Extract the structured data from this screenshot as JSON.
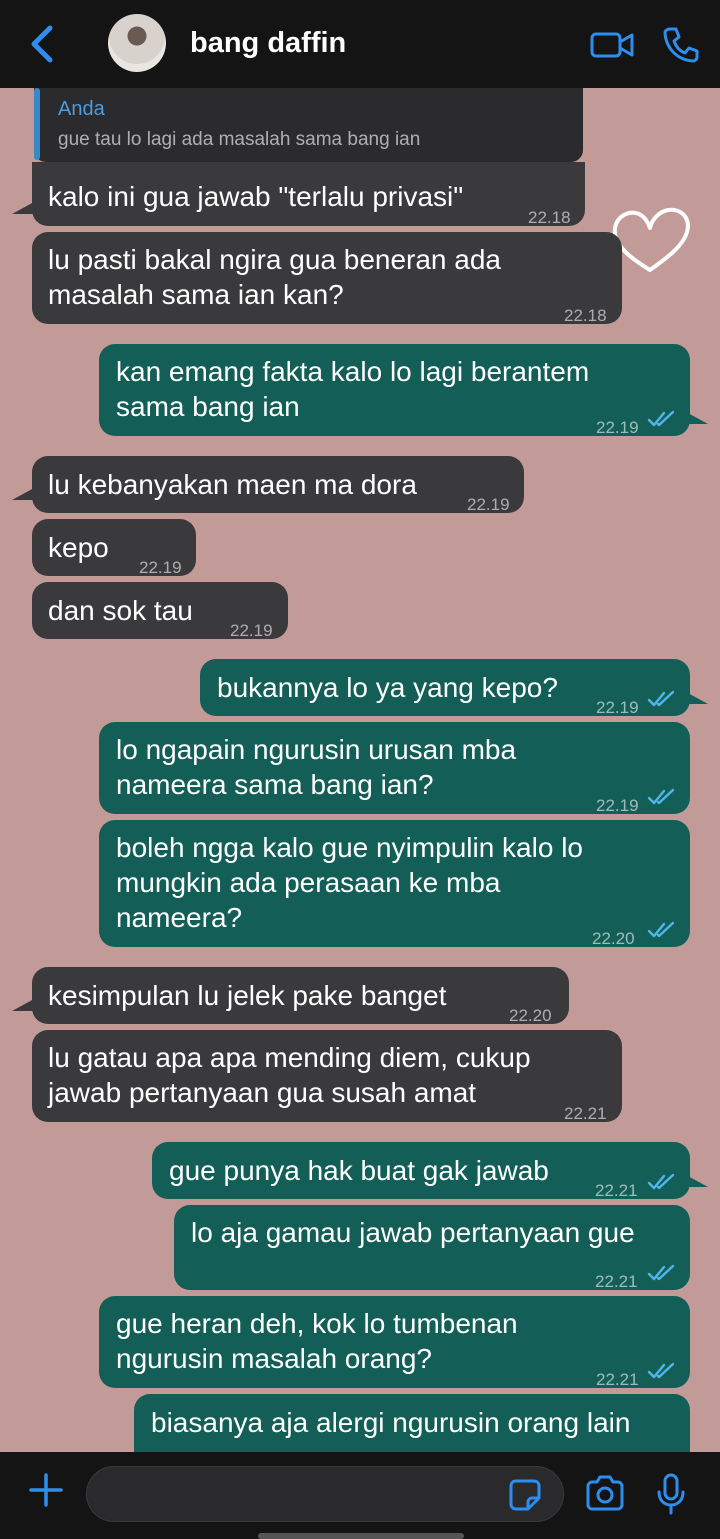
{
  "header": {
    "back_icon": "chevron-left-icon",
    "contact_name": "bang daffin",
    "video_icon": "video-camera-icon",
    "phone_icon": "phone-icon",
    "accent": "#2e8ef0"
  },
  "reply_quote": {
    "author": "Anda",
    "text": "gue tau lo lagi ada masalah sama bang ian"
  },
  "messages": [
    {
      "dir": "in",
      "text": "kalo ini gua jawab \"terlalu privasi\"",
      "time": "22.18"
    },
    {
      "dir": "in",
      "text": "lu pasti bakal ngira gua beneran ada\nmasalah sama ian kan?",
      "time": "22.18"
    },
    {
      "dir": "out",
      "text": "kan emang fakta kalo lo lagi berantem\nsama bang ian",
      "time": "22.19",
      "read": true
    },
    {
      "dir": "in",
      "text": "lu kebanyakan maen ma dora",
      "time": "22.19"
    },
    {
      "dir": "in",
      "text": "kepo",
      "time": "22.19"
    },
    {
      "dir": "in",
      "text": "dan sok tau",
      "time": "22.19"
    },
    {
      "dir": "out",
      "text": "bukannya lo ya yang kepo?",
      "time": "22.19",
      "read": true
    },
    {
      "dir": "out",
      "text": "lo ngapain ngurusin urusan mba\nnameera sama bang ian?",
      "time": "22.19",
      "read": true
    },
    {
      "dir": "out",
      "text": "boleh ngga kalo gue nyimpulin kalo lo\nmungkin ada perasaan ke mba\nnameera?",
      "time": "22.20",
      "read": true
    },
    {
      "dir": "in",
      "text": "kesimpulan lu jelek pake banget",
      "time": "22.20"
    },
    {
      "dir": "in",
      "text": "lu gatau apa apa mending diem, cukup\njawab pertanyaan gua susah amat",
      "time": "22.21"
    },
    {
      "dir": "out",
      "text": "gue punya hak buat gak jawab",
      "time": "22.21",
      "read": true
    },
    {
      "dir": "out",
      "text": "lo aja gamau jawab pertanyaan gue",
      "time": "22.21",
      "read": true
    },
    {
      "dir": "out",
      "text": "gue heran deh, kok lo tumbenan\nngurusin masalah orang?",
      "time": "22.21",
      "read": true
    },
    {
      "dir": "out",
      "text": "biasanya aja alergi ngurusin orang lain",
      "time": "",
      "read": false
    }
  ],
  "composer": {
    "plus_icon": "plus-icon",
    "sticker_icon": "sticker-icon",
    "camera_icon": "camera-icon",
    "mic_icon": "microphone-icon"
  },
  "colors": {
    "background": "#c29b98",
    "incoming_bubble": "#3a3a3c",
    "outgoing_bubble": "#135f57",
    "read_ticks": "#4fb6ec"
  }
}
